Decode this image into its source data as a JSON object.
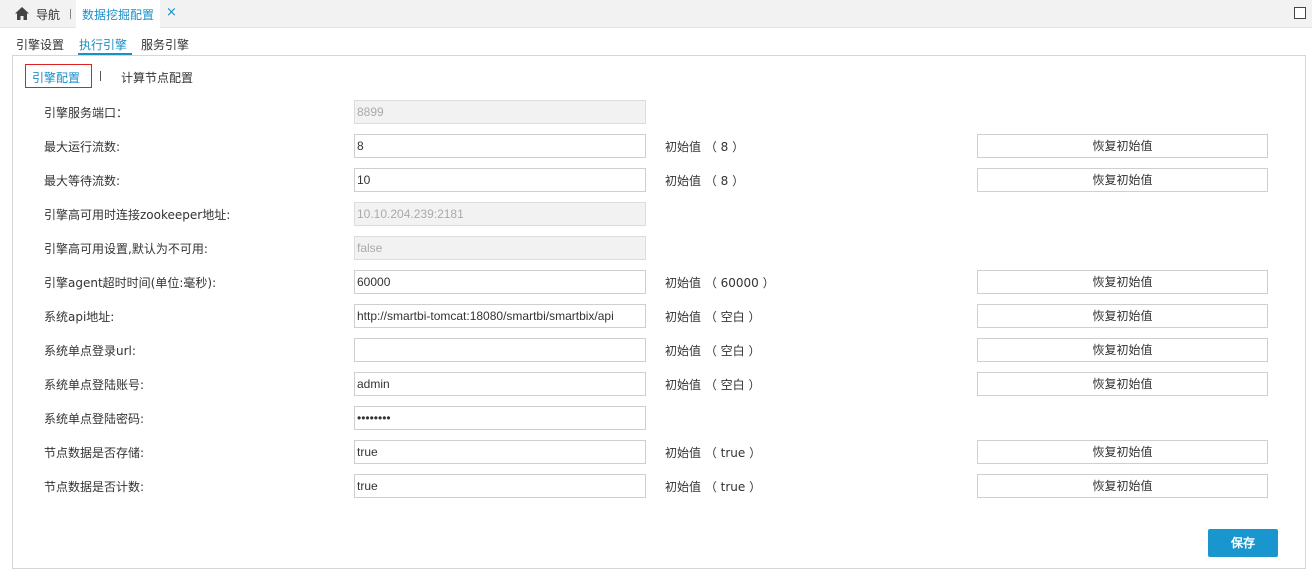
{
  "topbar": {
    "nav_label": "导航",
    "active_tab": "数据挖掘配置",
    "close_glyph": "×"
  },
  "subtabs": [
    {
      "label": "引擎设置",
      "active": false
    },
    {
      "label": "执行引擎",
      "active": true
    },
    {
      "label": "服务引擎",
      "active": false
    }
  ],
  "inner_tabs": {
    "active": "引擎配置",
    "separator": "|",
    "other": "计算节点配置"
  },
  "rows": [
    {
      "label": "引擎服务端口：",
      "value": "8899",
      "disabled": true,
      "initial": "",
      "reset": ""
    },
    {
      "label": "最大运行流数:",
      "value": "8",
      "disabled": false,
      "initial": "初始值 （ 8 ）",
      "reset": "恢复初始值"
    },
    {
      "label": "最大等待流数:",
      "value": "10",
      "disabled": false,
      "initial": "初始值 （ 8 ）",
      "reset": "恢复初始值"
    },
    {
      "label": "引擎高可用时连接zookeeper地址:",
      "value": "10.10.204.239:2181",
      "disabled": true,
      "initial": "",
      "reset": ""
    },
    {
      "label": "引擎高可用设置,默认为不可用:",
      "value": "false",
      "disabled": true,
      "initial": "",
      "reset": ""
    },
    {
      "label": "引擎agent超时时间(单位:毫秒):",
      "value": "60000",
      "disabled": false,
      "initial": "初始值 （ 60000 ）",
      "reset": "恢复初始值"
    },
    {
      "label": "系统api地址:",
      "value": "http://smartbi-tomcat:18080/smartbi/smartbix/api",
      "disabled": false,
      "initial": "初始值 （ 空白 ）",
      "reset": "恢复初始值"
    },
    {
      "label": "系统单点登录url:",
      "value": "",
      "disabled": false,
      "initial": "初始值 （ 空白 ）",
      "reset": "恢复初始值"
    },
    {
      "label": "系统单点登陆账号:",
      "value": "admin",
      "disabled": false,
      "initial": "初始值 （ 空白 ）",
      "reset": "恢复初始值"
    },
    {
      "label": "系统单点登陆密码:",
      "value": "••••••••",
      "disabled": false,
      "initial": "",
      "reset": ""
    },
    {
      "label": "节点数据是否存储:",
      "value": "true",
      "disabled": false,
      "initial": "初始值 （ true ）",
      "reset": "恢复初始值"
    },
    {
      "label": "节点数据是否计数:",
      "value": "true",
      "disabled": false,
      "initial": "初始值 （ true ）",
      "reset": "恢复初始值"
    }
  ],
  "save_label": "保存",
  "colors": {
    "accent": "#1a8fc9",
    "highlight_border": "#e02020",
    "save_button": "#1a96cf"
  }
}
